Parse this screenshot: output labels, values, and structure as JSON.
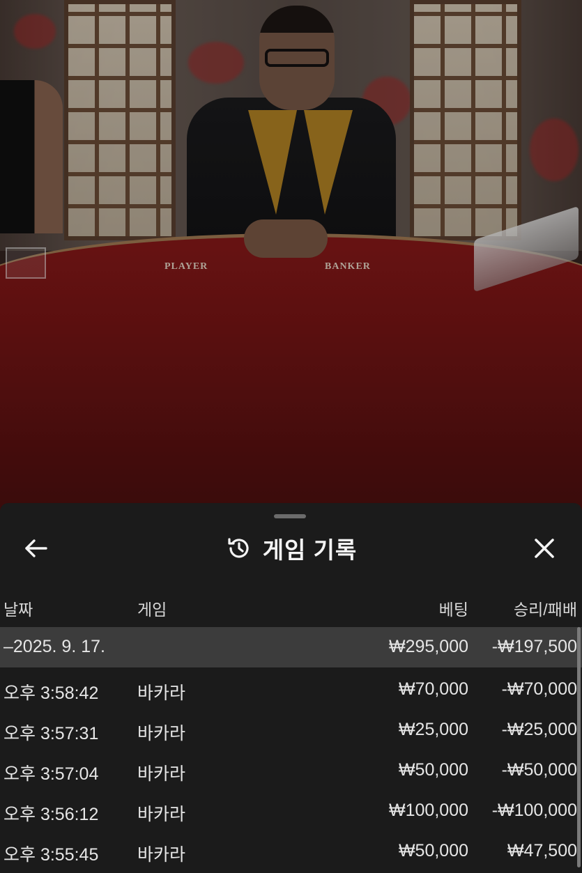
{
  "video": {
    "table_labels": [
      "PLAYER",
      "BANKER"
    ]
  },
  "sheet": {
    "title": "게임 기록",
    "icons": {
      "back": "arrow-left-icon",
      "history": "history-clock-icon",
      "close": "close-x-icon"
    },
    "columns": [
      "날짜",
      "게임",
      "베팅",
      "승리/패배"
    ],
    "summary": {
      "date": "–2025. 9. 17.",
      "bet": "₩295,000",
      "result": "-₩197,500"
    },
    "rows": [
      {
        "time": "오후 3:58:42",
        "game": "바카라",
        "bet": "₩70,000",
        "result": "-₩70,000"
      },
      {
        "time": "오후 3:57:31",
        "game": "바카라",
        "bet": "₩25,000",
        "result": "-₩25,000"
      },
      {
        "time": "오후 3:57:04",
        "game": "바카라",
        "bet": "₩50,000",
        "result": "-₩50,000"
      },
      {
        "time": "오후 3:56:12",
        "game": "바카라",
        "bet": "₩100,000",
        "result": "-₩100,000"
      },
      {
        "time": "오후 3:55:45",
        "game": "바카라",
        "bet": "₩50,000",
        "result": "₩47,500"
      }
    ]
  },
  "colors": {
    "sheet_bg": "#1b1b1b",
    "summary_bg": "#3c3c3c",
    "table_felt": "#7a1515",
    "lapel_gold": "#b58424"
  }
}
